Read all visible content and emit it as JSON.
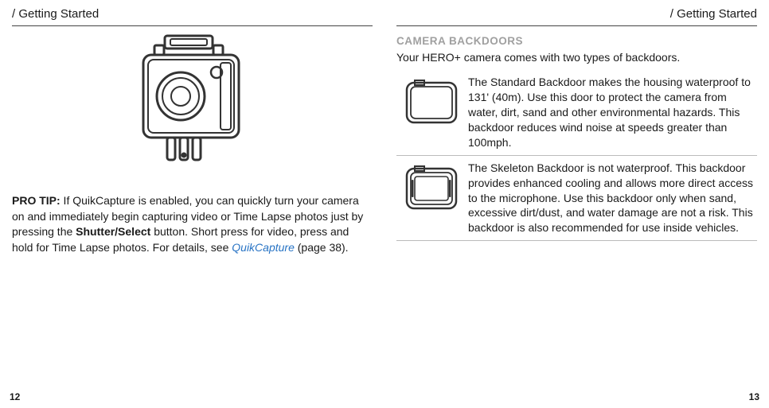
{
  "left": {
    "header": "/ Getting Started",
    "tip_label": "PRO TIP:",
    "tip_text_1": " If QuikCapture is enabled, you can quickly turn your camera on and immediately begin capturing video or Time Lapse photos just by pressing the ",
    "bold_button": "Shutter/Select",
    "tip_text_2": " button. Short press for video, press and hold for Time Lapse photos. For details, see ",
    "link": "QuikCapture",
    "tip_text_3": " (page 38).",
    "page_num": "12"
  },
  "right": {
    "header": "/ Getting Started",
    "section_heading": "CAMERA BACKDOORS",
    "section_sub": "Your HERO+ camera comes with two types of backdoors.",
    "rows": [
      {
        "text": "The Standard Backdoor makes the housing waterproof to 131' (40m). Use this door to protect the camera from water, dirt, sand and other environmental hazards. This backdoor reduces wind noise at speeds greater than 100mph."
      },
      {
        "text": "The Skeleton Backdoor is not waterproof. This backdoor provides enhanced cooling and allows more direct access to the microphone. Use this backdoor only when sand, excessive dirt/dust, and water damage are not a risk. This backdoor is also recommended for use inside vehicles."
      }
    ],
    "page_num": "13"
  }
}
